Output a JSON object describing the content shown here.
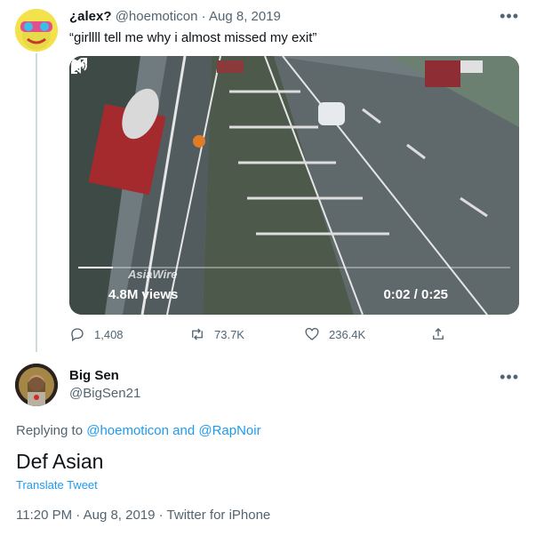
{
  "tweet1": {
    "display_name": "¿alex?",
    "handle": "@hoemoticon",
    "separator": "·",
    "date": "Aug 8, 2019",
    "text": "“girllll tell me why i almost missed my exit”",
    "more_icon": "more-dots-icon",
    "video": {
      "views": "4.8M views",
      "time": "0:02 / 0:25",
      "watermark": "AsiaWire",
      "progress_fraction": 0.08,
      "play_icon": "play-icon",
      "volume_icon": "volume-icon",
      "fullscreen_icon": "fullscreen-icon"
    },
    "actions": {
      "replies": "1,408",
      "retweets": "73.7K",
      "likes": "236.4K"
    }
  },
  "tweet2": {
    "display_name": "Big Sen",
    "handle": "@BigSen21",
    "more_icon": "more-dots-icon",
    "replying_prefix": "Replying to",
    "replying_users": "@hoemoticon and @RapNoir",
    "text": "Def Asian",
    "translate": "Translate Tweet",
    "meta": "11:20 PM · Aug 8, 2019 · Twitter for iPhone"
  },
  "colors": {
    "accent": "#1d9bf0",
    "muted": "#536471",
    "thread_line": "#cfd9de"
  }
}
